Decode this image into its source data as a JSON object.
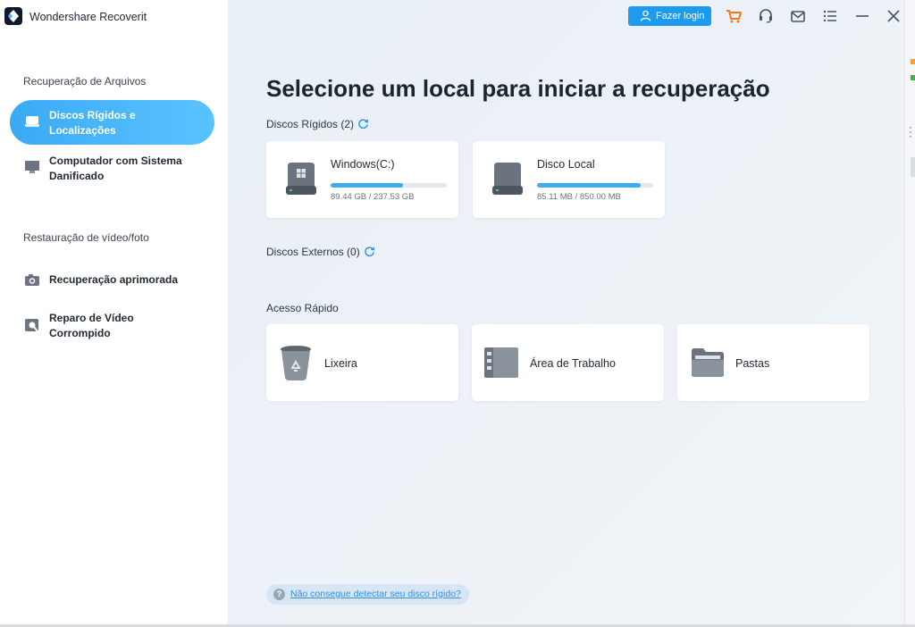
{
  "app": {
    "title": "Wondershare Recoverit"
  },
  "sidebar": {
    "section1_label": "Recuperação de Arquivos",
    "section2_label": "Restauração de vídeo/foto",
    "items": [
      {
        "label_line1": "Discos Rígidos e",
        "label_line2": "Localizações",
        "active": true
      },
      {
        "label_line1": "Computador com Sistema",
        "label_line2": "Danificado"
      },
      {
        "label": "Recuperação aprimorada"
      },
      {
        "label_line1": "Reparo de Vídeo",
        "label_line2": "Corrompido"
      }
    ]
  },
  "header": {
    "login_label": "Fazer login"
  },
  "main": {
    "heading": "Selecione um local para iniciar a recuperação",
    "hard_disks_label": "Discos Rígidos (2)",
    "external_label": "Discos Externos (0)",
    "quick_access_label": "Acesso Rápido",
    "disks": [
      {
        "name": "Windows(C:)",
        "size": "89.44 GB / 237.53 GB",
        "usage": 0.62
      },
      {
        "name": "Disco Local",
        "size": "85.11 MB / 850.00 MB",
        "usage": 0.89
      }
    ],
    "quick": [
      {
        "label": "Lixeira",
        "icon": "recycle-bin-icon"
      },
      {
        "label": "Área de Trabalho",
        "icon": "desktop-icon"
      },
      {
        "label": "Pastas",
        "icon": "folder-icon"
      }
    ],
    "help_text": "Não consegue detectar seu disco rígido?"
  },
  "colors": {
    "accent": "#1e9bf0",
    "cart": "#f27a1a",
    "progress": "#3aacef"
  }
}
